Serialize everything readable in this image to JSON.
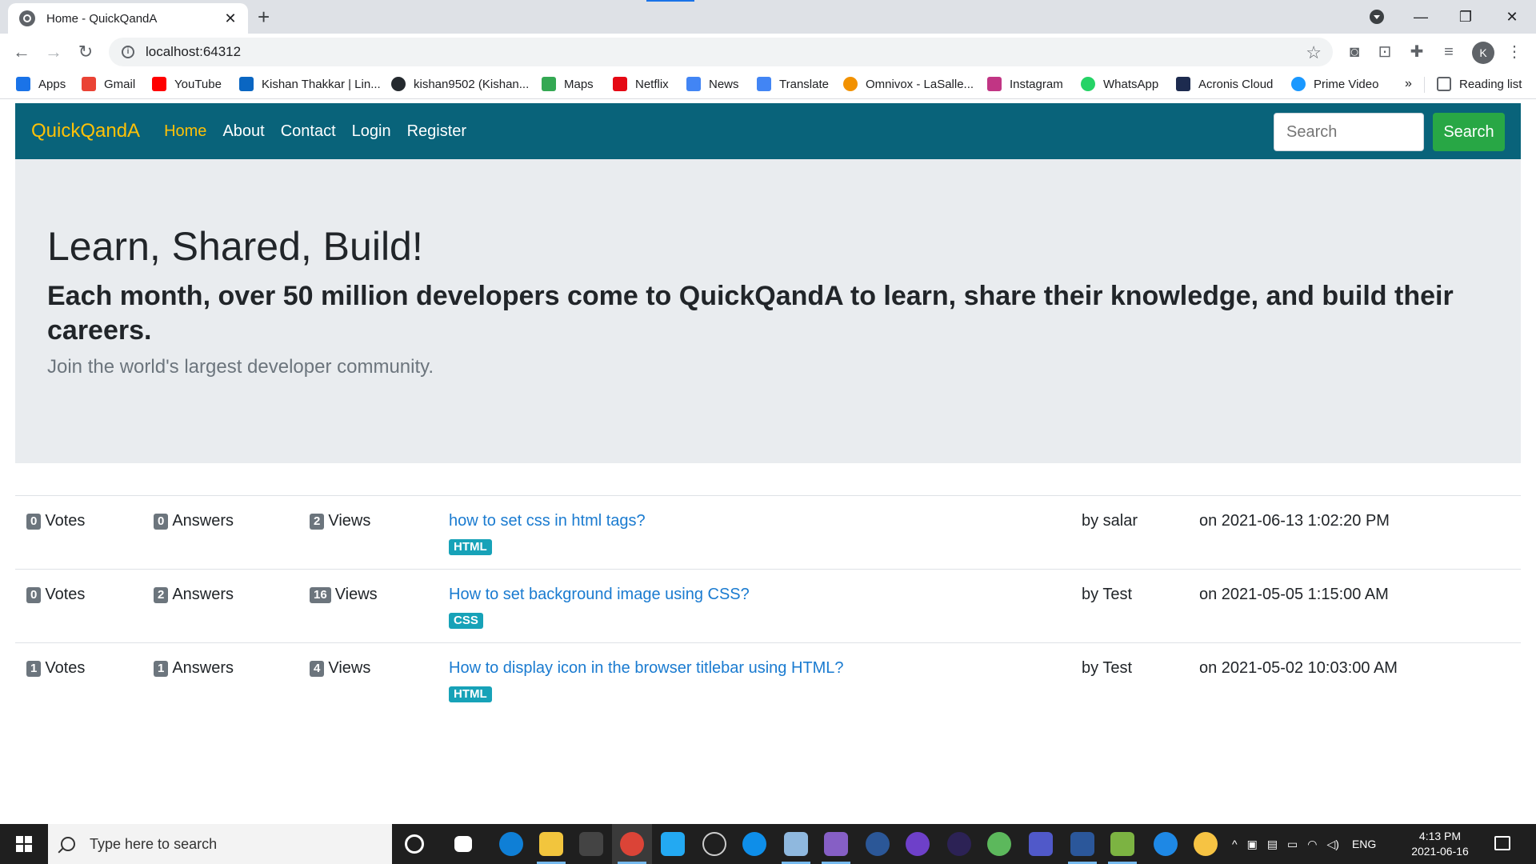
{
  "browser": {
    "tab_title": "Home - QuickQandA",
    "tab_close": "✕",
    "new_tab": "+",
    "url": "localhost:64312",
    "profile_initial": "K",
    "bookmarks": [
      {
        "label": "Apps",
        "icon": "apps-grid-icon",
        "color": "#1a73e8"
      },
      {
        "label": "Gmail",
        "icon": "gmail-icon",
        "color": "#ea4335"
      },
      {
        "label": "YouTube",
        "icon": "youtube-icon",
        "color": "#ff0000"
      },
      {
        "label": "Kishan Thakkar | Lin...",
        "icon": "linkedin-icon",
        "color": "#0a66c2"
      },
      {
        "label": "kishan9502 (Kishan...",
        "icon": "github-icon",
        "color": "#24292e"
      },
      {
        "label": "Maps",
        "icon": "maps-icon",
        "color": "#34a853"
      },
      {
        "label": "Netflix",
        "icon": "netflix-icon",
        "color": "#e50914"
      },
      {
        "label": "News",
        "icon": "news-icon",
        "color": "#4285f4"
      },
      {
        "label": "Translate",
        "icon": "translate-icon",
        "color": "#4285f4"
      },
      {
        "label": "Omnivox - LaSalle...",
        "icon": "omnivox-icon",
        "color": "#f29100"
      },
      {
        "label": "Instagram",
        "icon": "instagram-icon",
        "color": "#c13584"
      },
      {
        "label": "WhatsApp",
        "icon": "whatsapp-icon",
        "color": "#25d366"
      },
      {
        "label": "Acronis Cloud",
        "icon": "acronis-icon",
        "color": "#1d2b4f"
      },
      {
        "label": "Prime Video",
        "icon": "prime-video-icon",
        "color": "#1a98ff"
      }
    ],
    "bookmarks_more": "»",
    "reading_list": "Reading list"
  },
  "navbar": {
    "brand": "QuickQandA",
    "links": [
      "Home",
      "About",
      "Contact",
      "Login",
      "Register"
    ],
    "search_placeholder": "Search",
    "search_button": "Search"
  },
  "hero": {
    "title": "Learn, Shared, Build!",
    "subtitle": "Each month, over 50 million developers come to QuickQandA to learn, share their knowledge, and build their careers.",
    "lead": "Join the world's largest developer community."
  },
  "questions": [
    {
      "votes": "0",
      "votes_label": "Votes",
      "answers": "0",
      "answers_label": "Answers",
      "views": "2",
      "views_label": "Views",
      "title": "how to set css in html tags?",
      "tag": "HTML",
      "author": "by salar",
      "date": "on 2021-06-13 1:02:20 PM"
    },
    {
      "votes": "0",
      "votes_label": "Votes",
      "answers": "2",
      "answers_label": "Answers",
      "views": "16",
      "views_label": "Views",
      "title": "How to set background image using CSS?",
      "tag": "CSS",
      "author": "by Test",
      "date": "on 2021-05-05 1:15:00 AM"
    },
    {
      "votes": "1",
      "votes_label": "Votes",
      "answers": "1",
      "answers_label": "Answers",
      "views": "4",
      "views_label": "Views",
      "title": "How to display icon in the browser titlebar using HTML?",
      "tag": "HTML",
      "author": "by Test",
      "date": "on 2021-05-02 10:03:00 AM"
    }
  ],
  "taskbar": {
    "search_placeholder": "Type here to search",
    "language": "ENG",
    "time": "4:13 PM",
    "date": "2021-06-16"
  },
  "colors": {
    "navbar_bg": "#09637a",
    "brand": "#ffc107",
    "jumbotron_bg": "#e9ecef",
    "search_button": "#28a745",
    "tag_bg": "#17a2b8",
    "link": "#1a7bd0"
  }
}
